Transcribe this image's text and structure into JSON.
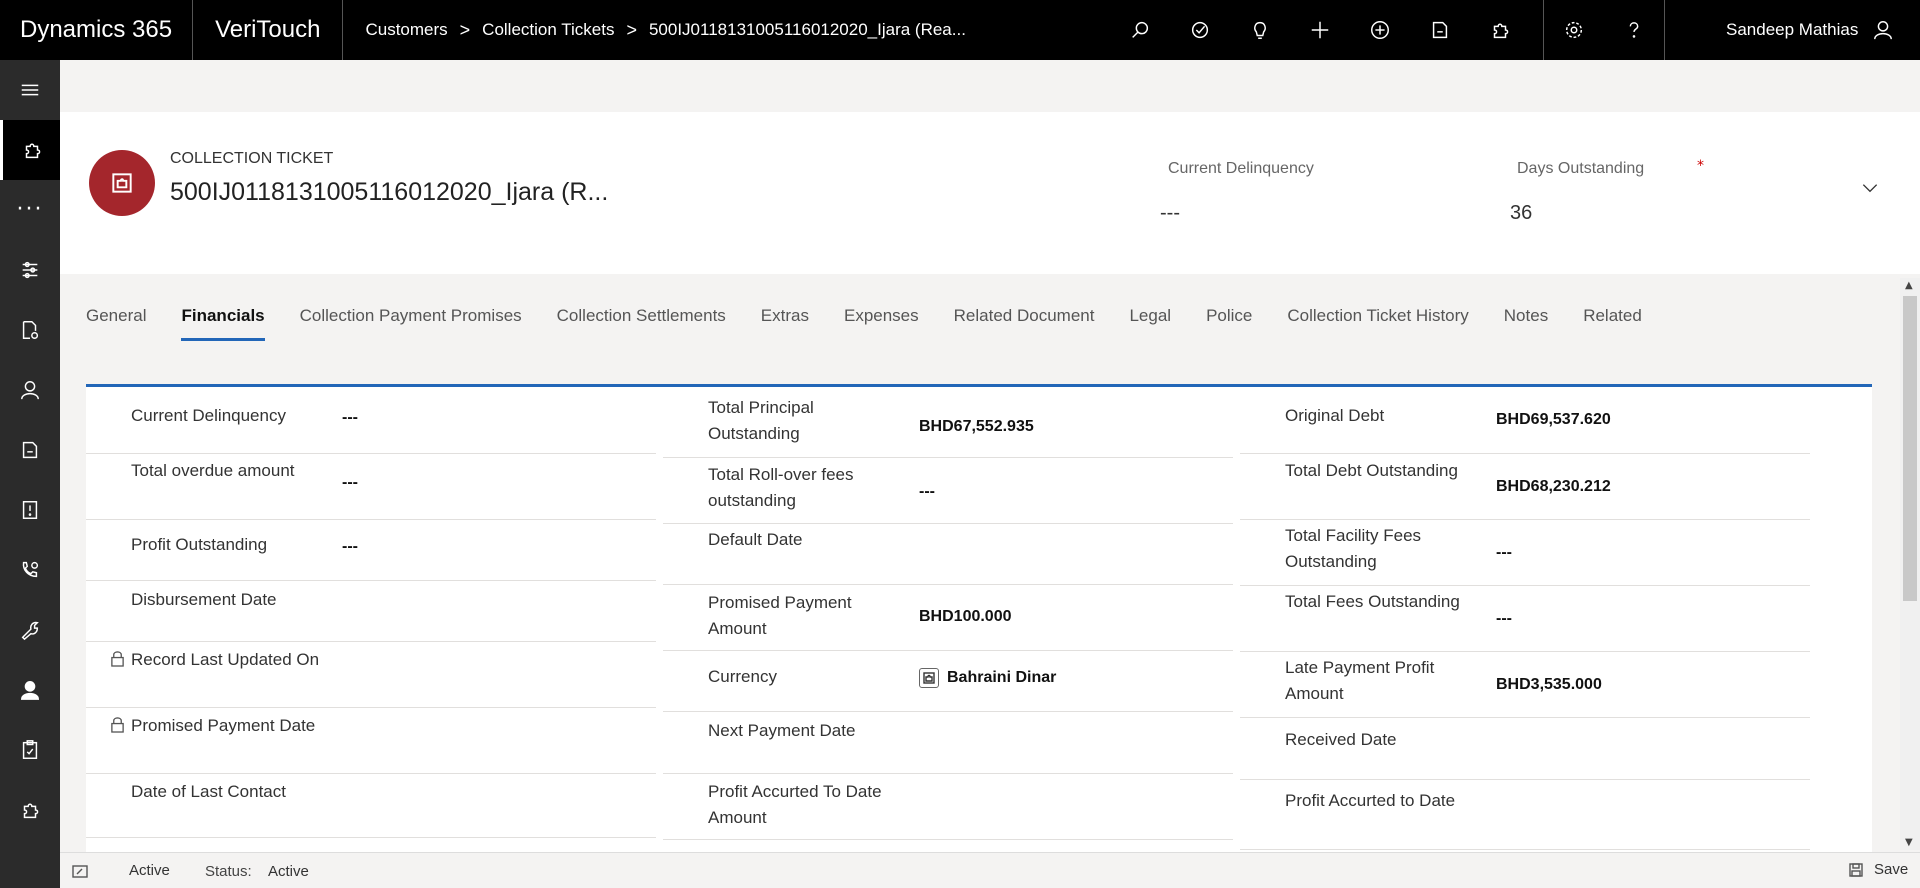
{
  "topbar": {
    "brand": "Dynamics 365",
    "app_name": "VeriTouch",
    "breadcrumbs": [
      "Customers",
      "Collection Tickets",
      "500IJ0118131005116012020_Ijara (Rea..."
    ],
    "icons": [
      "search-icon",
      "task-flow-icon",
      "lightbulb-icon",
      "plus-icon",
      "circle-plus-icon",
      "advanced-find-icon",
      "puzzle-icon"
    ],
    "settings_icons": [
      "gear-icon",
      "help-icon"
    ],
    "user_name": "Sandeep Mathias"
  },
  "sidebar": {
    "items": [
      "hamburger-icon",
      "puzzle-icon",
      "more-icon",
      "dashboard-icon",
      "document-settings-icon",
      "person-icon",
      "book-icon",
      "report-icon",
      "phone-settings-icon",
      "wrench-icon",
      "user-active-icon",
      "clipboard-icon",
      "gear-puzzle-icon"
    ]
  },
  "header": {
    "entity_type": "COLLECTION TICKET",
    "record_title": "500IJ0118131005116012020_Ijara (R...",
    "fields": [
      {
        "label": "Current Delinquency",
        "value": "---"
      },
      {
        "label": "Days Outstanding",
        "value": "36",
        "required_mark": "*"
      }
    ]
  },
  "tabs": [
    "General",
    "Financials",
    "Collection Payment Promises",
    "Collection Settlements",
    "Extras",
    "Expenses",
    "Related Document",
    "Legal",
    "Police",
    "Collection Ticket History",
    "Notes",
    "Related"
  ],
  "active_tab": "Financials",
  "columns": [
    [
      {
        "label": "Current Delinquency",
        "value": "---"
      },
      {
        "label": "Total overdue amount",
        "value": "---"
      },
      {
        "label": "Profit Outstanding",
        "value": "---"
      },
      {
        "label": "Disbursement Date",
        "value": ""
      },
      {
        "label": "Record Last Updated On",
        "value": "",
        "locked": true
      },
      {
        "label": "Promised Payment Date",
        "value": "",
        "locked": true
      },
      {
        "label": "Date of Last Contact",
        "value": ""
      }
    ],
    [
      {
        "label": "Total Principal Outstanding",
        "value": "BHD67,552.935"
      },
      {
        "label": "Total Roll-over fees outstanding",
        "value": "---"
      },
      {
        "label": "Default Date",
        "value": ""
      },
      {
        "label": "Promised Payment Amount",
        "value": "BHD100.000"
      },
      {
        "label": "Currency",
        "value": "Bahraini Dinar",
        "lookup": true
      },
      {
        "label": "Next Payment Date",
        "value": ""
      },
      {
        "label": "Profit Accurted To Date Amount",
        "value": ""
      }
    ],
    [
      {
        "label": "Original Debt",
        "value": "BHD69,537.620"
      },
      {
        "label": "Total Debt Outstanding",
        "value": "BHD68,230.212"
      },
      {
        "label": "Total Facility Fees Outstanding",
        "value": "---"
      },
      {
        "label": "Total Fees Outstanding",
        "value": "---"
      },
      {
        "label": "Late Payment Profit Amount",
        "value": "BHD3,535.000"
      },
      {
        "label": "Received Date",
        "value": ""
      },
      {
        "label": "Profit Accurted to Date",
        "value": ""
      }
    ]
  ],
  "statusbar": {
    "state": "Active",
    "status_label": "Status:",
    "status_value": "Active",
    "save_label": "Save"
  },
  "colors": {
    "accent": "#2266b8",
    "avatar": "#a4262c",
    "topbar": "#000000",
    "sidebar": "#2b2b2b"
  }
}
